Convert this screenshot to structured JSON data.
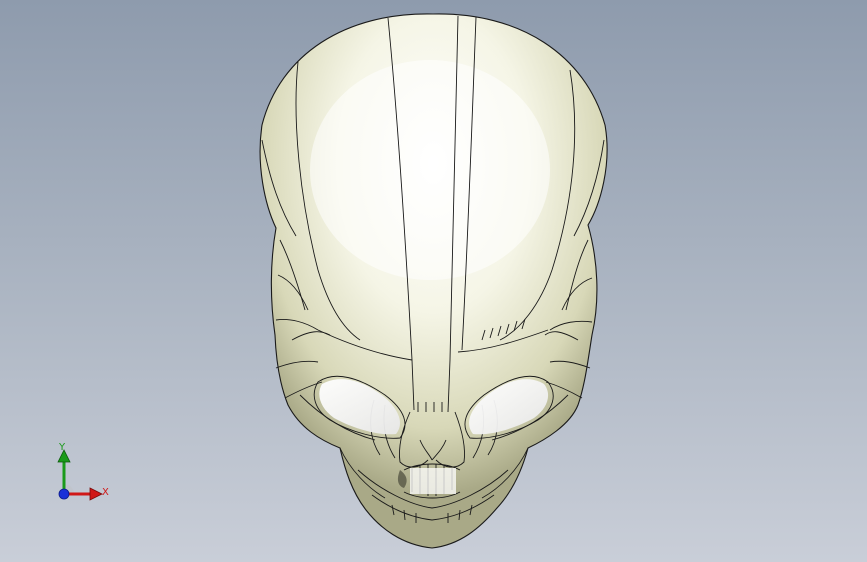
{
  "viewport": {
    "model_name": "skull-model",
    "background_top": "#8e9bad",
    "background_bottom": "#c9ced8",
    "model_color": "#e6e6c8",
    "edge_color": "#1a1a1a"
  },
  "triad": {
    "y_label": "Y",
    "x_label": "X",
    "y_color": "#1a9a1a",
    "x_color": "#d01818",
    "z_color": "#1a30d8"
  }
}
